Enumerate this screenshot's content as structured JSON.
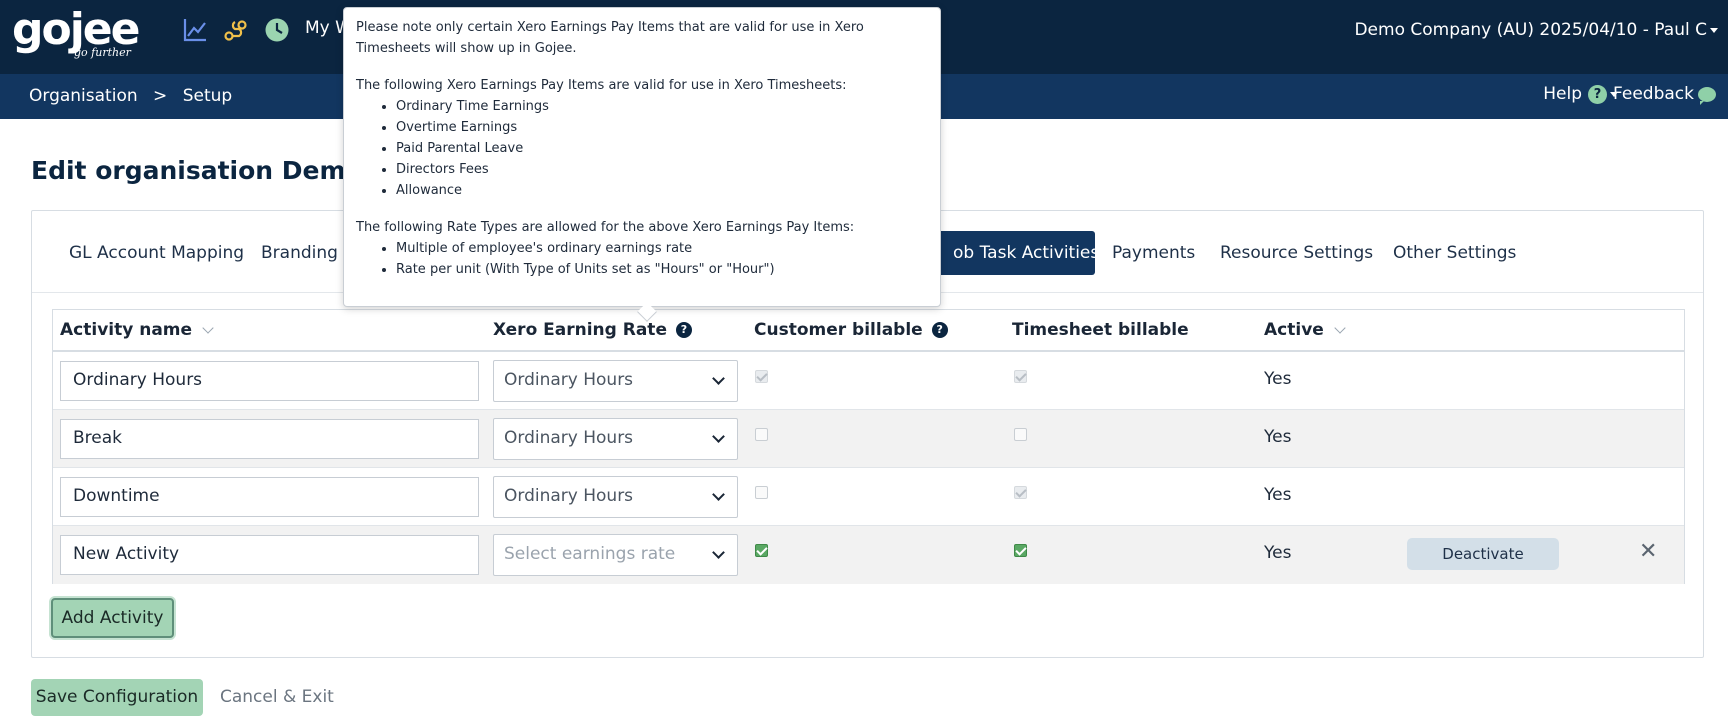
{
  "topbar": {
    "logo": "gojee",
    "logo_tagline": "go further",
    "nav_partial": "My W",
    "company": "Demo Company (AU) 2025/04/10 - Paul C"
  },
  "subbar": {
    "breadcrumb": [
      "Organisation",
      ">",
      "Setup"
    ],
    "help": "Help",
    "feedback": "Feedback"
  },
  "page": {
    "title": "Edit organisation Demo Co"
  },
  "tabs": [
    {
      "label": "GL Account Mapping"
    },
    {
      "label": "Branding T"
    },
    {
      "label": "ob Task Activities",
      "active": true
    },
    {
      "label": "Payments"
    },
    {
      "label": "Resource Settings"
    },
    {
      "label": "Other Settings"
    }
  ],
  "grid": {
    "headers": {
      "activity": "Activity name",
      "rate": "Xero Earning Rate",
      "customer": "Customer billable",
      "timesheet": "Timesheet billable",
      "active": "Active"
    },
    "rows": [
      {
        "name": "Ordinary Hours",
        "rate": "Ordinary Hours",
        "customer_billable": true,
        "timesheet_billable": true,
        "active": "Yes"
      },
      {
        "name": "Break",
        "rate": "Ordinary Hours",
        "customer_billable": false,
        "timesheet_billable": false,
        "active": "Yes"
      },
      {
        "name": "Downtime",
        "rate": "Ordinary Hours",
        "customer_billable": false,
        "timesheet_billable": true,
        "active": "Yes"
      },
      {
        "name": "New Activity",
        "rate_placeholder": "Select earnings rate",
        "customer_billable": true,
        "timesheet_billable": true,
        "active": "Yes",
        "deactivate": "Deactivate",
        "remove": "✕"
      }
    ]
  },
  "buttons": {
    "add_activity": "Add Activity",
    "save": "Save Configuration",
    "cancel": "Cancel & Exit"
  },
  "tooltip": {
    "intro": "Please note only certain Xero Earnings Pay Items that are valid for use in Xero Timesheets will show up in Gojee.",
    "valid_heading": "The following Xero Earnings Pay Items are valid for use in Xero Timesheets:",
    "valid_items": [
      "Ordinary Time Earnings",
      "Overtime Earnings",
      "Paid Parental Leave",
      "Directors Fees",
      "Allowance"
    ],
    "rate_heading": "The following Rate Types are allowed for the above Xero Earnings Pay Items:",
    "rate_items": [
      "Multiple of employee's ordinary earnings rate",
      "Rate per unit (With Type of Units set as \"Hours\" or \"Hour\")"
    ]
  },
  "colors": {
    "topbar": "#0b2540",
    "subbar": "#123660",
    "accent_green": "#a3d4b5",
    "active_tab": "#123660"
  }
}
